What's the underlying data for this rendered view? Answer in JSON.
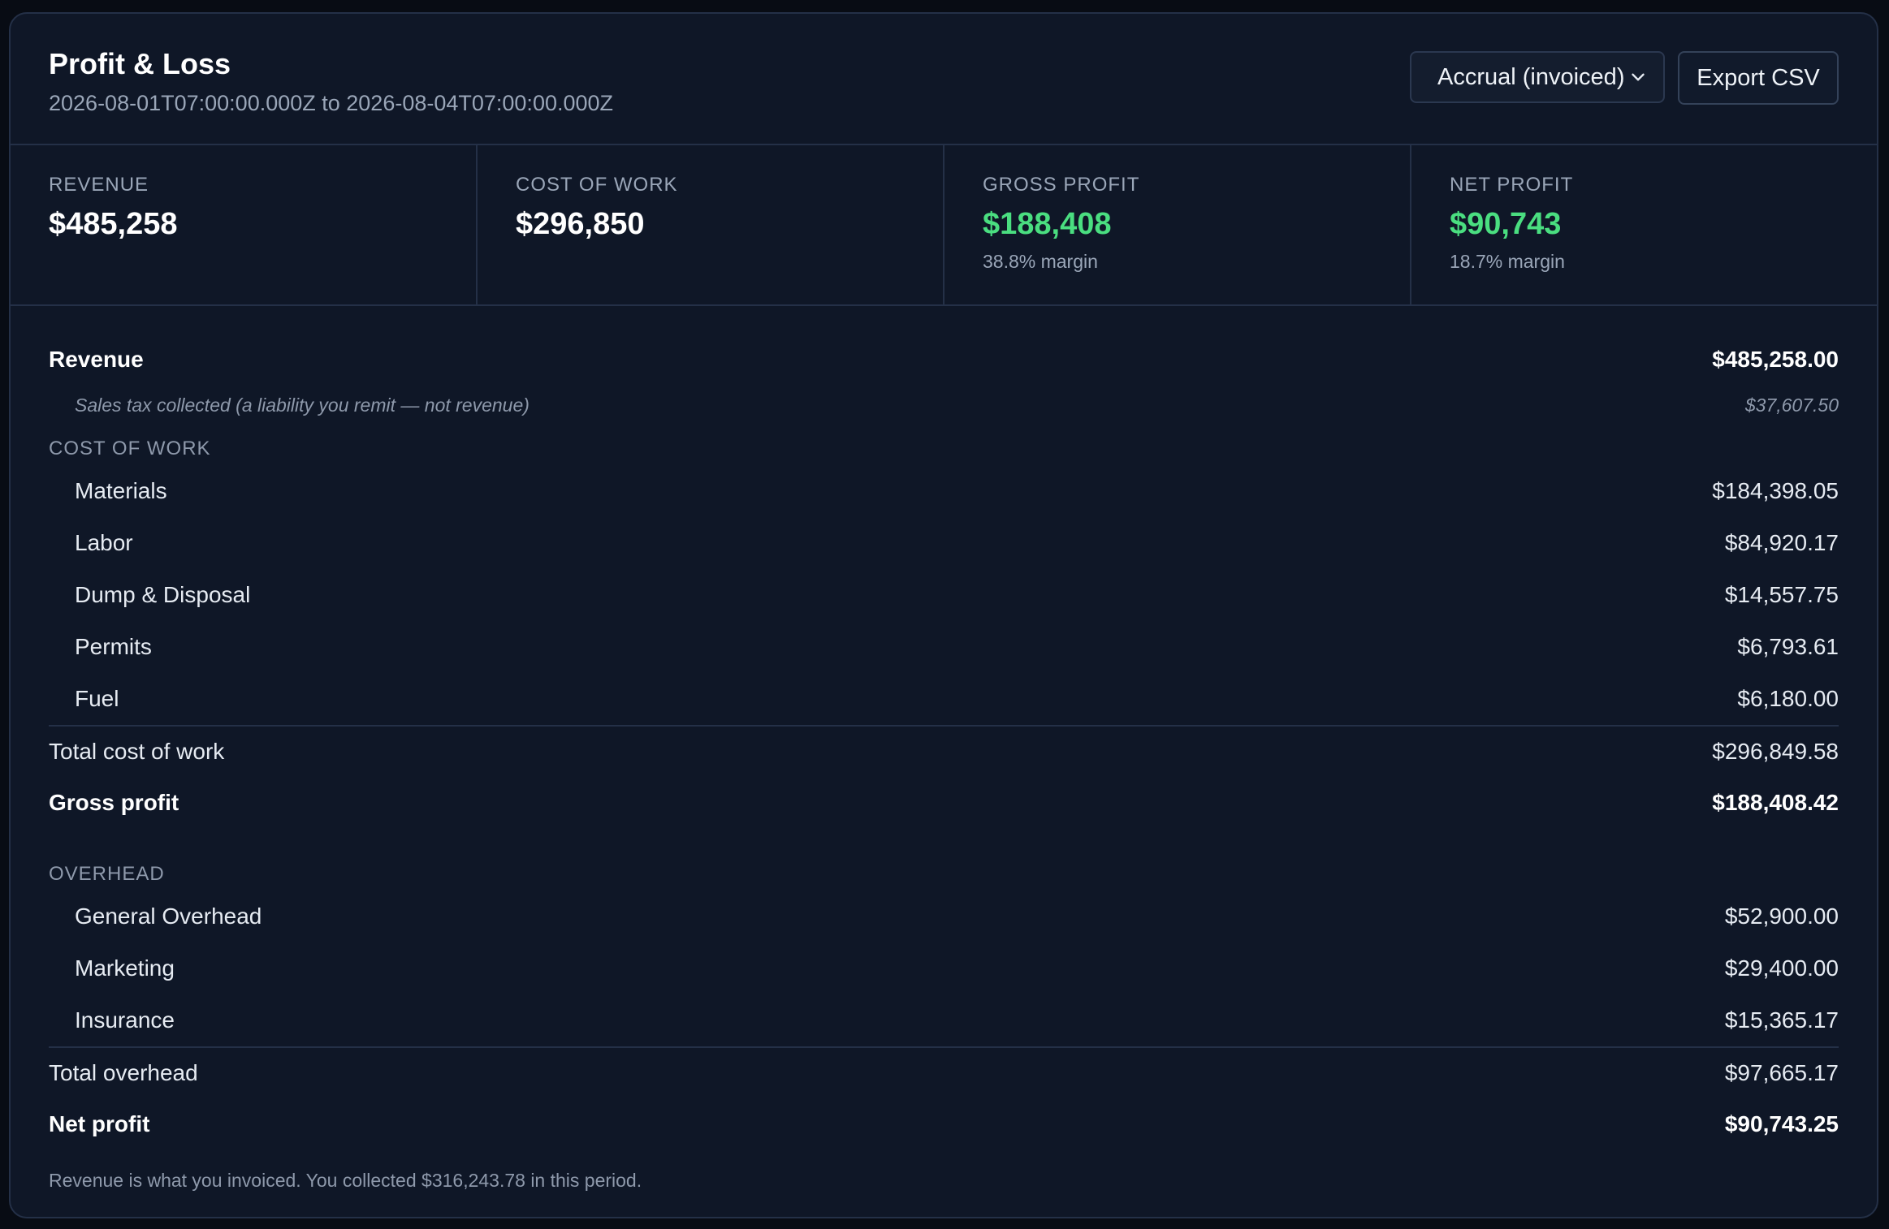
{
  "header": {
    "title": "Profit & Loss",
    "date_range": "2026-08-01T07:00:00.000Z to 2026-08-04T07:00:00.000Z",
    "basis_select_value": "Accrual (invoiced)",
    "export_label": "Export CSV"
  },
  "kpis": [
    {
      "label": "REVENUE",
      "value": "$485,258",
      "sub": ""
    },
    {
      "label": "COST OF WORK",
      "value": "$296,850",
      "sub": ""
    },
    {
      "label": "GROSS PROFIT",
      "value": "$188,408",
      "sub": "38.8% margin"
    },
    {
      "label": "NET PROFIT",
      "value": "$90,743",
      "sub": "18.7% margin"
    }
  ],
  "statement": {
    "revenue": {
      "label": "Revenue",
      "amount": "$485,258.00"
    },
    "sales_tax": {
      "label": "Sales tax collected (a liability you remit — not revenue)",
      "amount": "$37,607.50"
    },
    "cost_section": "COST OF WORK",
    "cost_items": [
      {
        "label": "Materials",
        "amount": "$184,398.05"
      },
      {
        "label": "Labor",
        "amount": "$84,920.17"
      },
      {
        "label": "Dump & Disposal",
        "amount": "$14,557.75"
      },
      {
        "label": "Permits",
        "amount": "$6,793.61"
      },
      {
        "label": "Fuel",
        "amount": "$6,180.00"
      }
    ],
    "total_cost": {
      "label": "Total cost of work",
      "amount": "$296,849.58"
    },
    "gross_profit": {
      "label": "Gross profit",
      "amount": "$188,408.42"
    },
    "overhead_section": "OVERHEAD",
    "overhead_items": [
      {
        "label": "General Overhead",
        "amount": "$52,900.00"
      },
      {
        "label": "Marketing",
        "amount": "$29,400.00"
      },
      {
        "label": "Insurance",
        "amount": "$15,365.17"
      }
    ],
    "total_overhead": {
      "label": "Total overhead",
      "amount": "$97,665.17"
    },
    "net_profit": {
      "label": "Net profit",
      "amount": "$90,743.25"
    }
  },
  "footnote": "Revenue is what you invoiced. You collected $316,243.78 in this period.",
  "colors": {
    "positive": "#4ade80",
    "background": "#0f1727",
    "border": "#243047"
  },
  "icons": {
    "select_chevron": "chevron-down-icon"
  }
}
